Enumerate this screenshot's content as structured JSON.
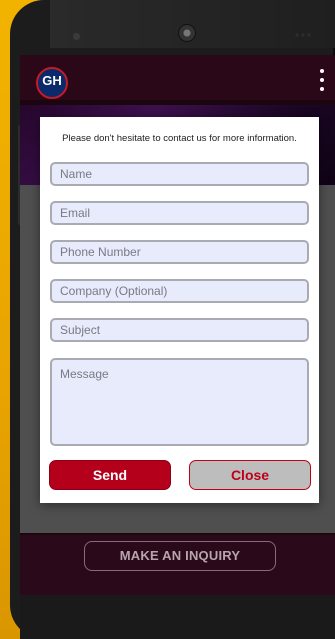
{
  "app": {
    "logo_text": "GH"
  },
  "dialog": {
    "intro": "Please don't hesitate to contact us for more information.",
    "fields": {
      "name": "Name",
      "email": "Email",
      "phone": "Phone Number",
      "company": "Company (Optional)",
      "subject": "Subject",
      "message": "Message"
    },
    "send_label": "Send",
    "close_label": "Close"
  },
  "bottom": {
    "inquiry_label": "MAKE AN INQUIRY"
  },
  "colors": {
    "brand_red": "#b5001b",
    "appbar": "#2a0818",
    "field_bg": "#e8ebfb"
  },
  "icons": {
    "menu": "overflow-menu-icon"
  }
}
